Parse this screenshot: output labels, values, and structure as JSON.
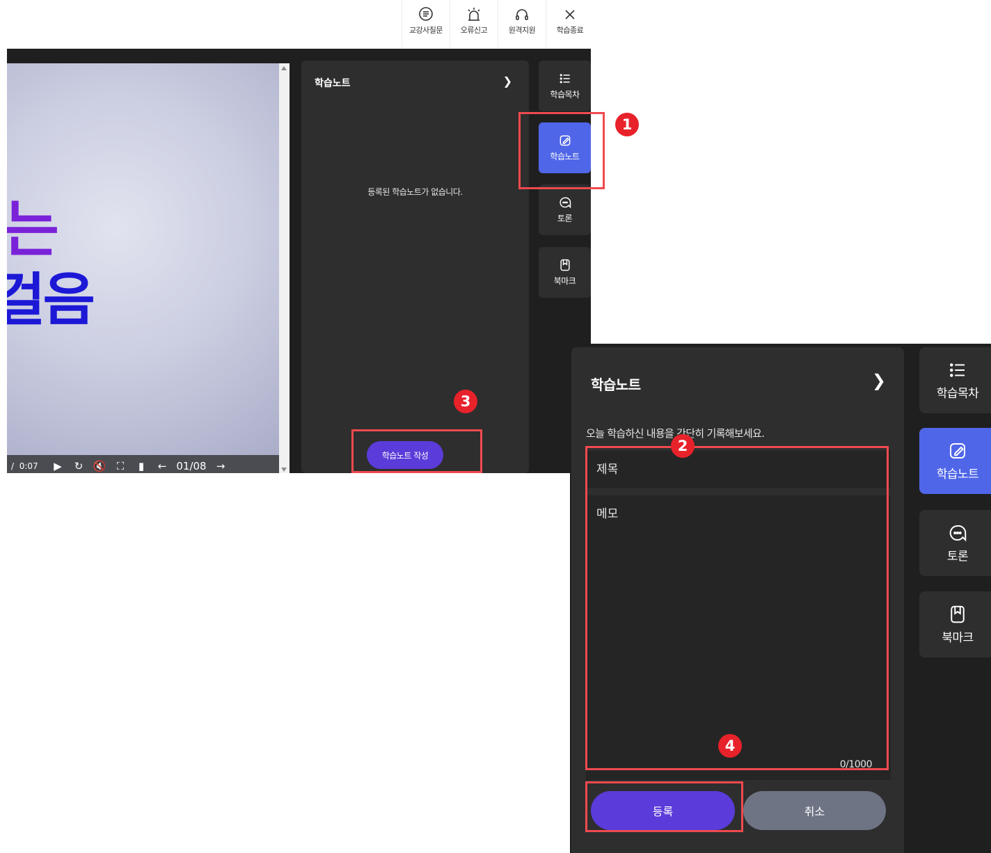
{
  "toolbar": {
    "items": [
      {
        "label": "교강사질문",
        "icon": "question-doc-icon"
      },
      {
        "label": "오류신고",
        "icon": "alarm-siren-icon"
      },
      {
        "label": "원격지원",
        "icon": "headset-icon"
      },
      {
        "label": "학습종료",
        "icon": "close-icon"
      }
    ]
  },
  "player": {
    "slide_text_line1": "는",
    "slide_text_line2": "걸음",
    "time_sep": "/",
    "time_total": "0:07",
    "page": "01/08"
  },
  "note_panel_small": {
    "title": "학습노트",
    "empty_message": "등록된 학습노트가 없습니다.",
    "write_button": "학습노트 작성"
  },
  "sidebar": {
    "items": [
      {
        "label": "학습목차",
        "icon": "list-icon"
      },
      {
        "label": "학습노트",
        "icon": "edit-note-icon",
        "active": true
      },
      {
        "label": "토론",
        "icon": "chat-bubble-icon"
      },
      {
        "label": "북마크",
        "icon": "bookmark-icon"
      }
    ]
  },
  "note_panel_large": {
    "title": "학습노트",
    "guide": "오늘 학습하신 내용을 간단히 기록해보세요.",
    "title_placeholder": "제목",
    "memo_placeholder": "메모",
    "char_count": "0/1000",
    "submit_label": "등록",
    "cancel_label": "취소"
  },
  "badges": [
    "1",
    "2",
    "3",
    "4"
  ],
  "colors": {
    "accent_purple": "#5b3bd9",
    "active_blue": "#4f66e8",
    "highlight_red": "#f04a4f",
    "badge_red": "#e8222a",
    "panel_dark": "#2e2e2e"
  }
}
